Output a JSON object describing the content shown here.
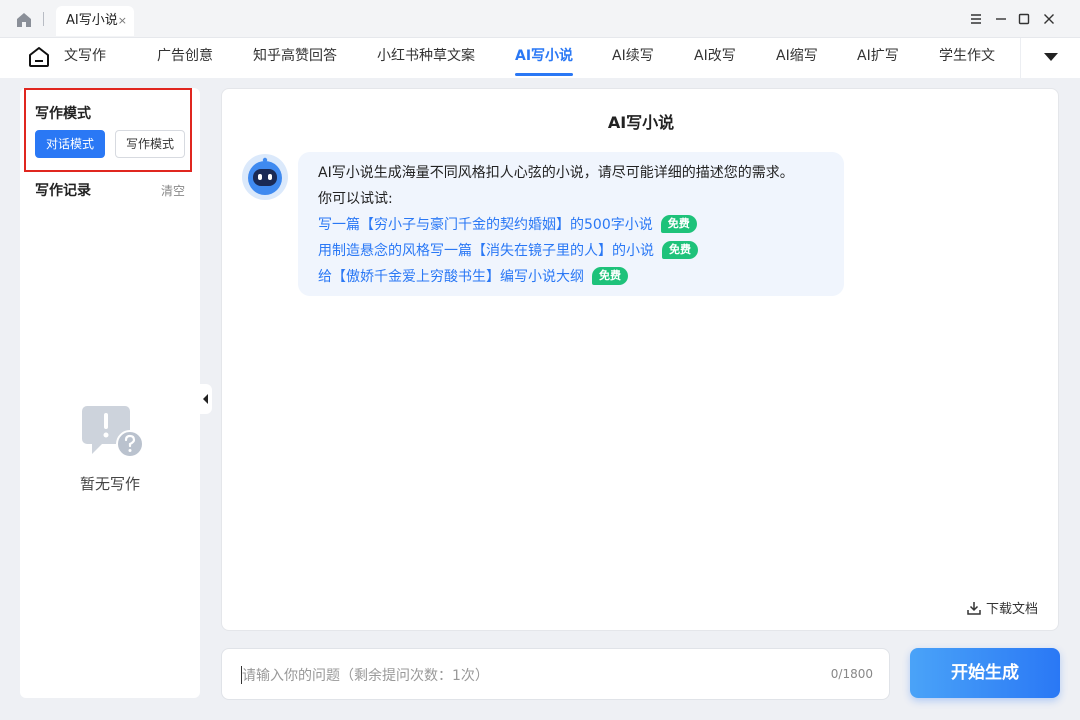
{
  "titlebar": {
    "tab_label": "AI写小说",
    "tab_close": "×"
  },
  "nav": {
    "items": [
      {
        "label": "文写作"
      },
      {
        "label": "广告创意"
      },
      {
        "label": "知乎高赞回答"
      },
      {
        "label": "小红书种草文案"
      },
      {
        "label": "AI写小说",
        "active": true
      },
      {
        "label": "AI续写"
      },
      {
        "label": "AI改写"
      },
      {
        "label": "AI缩写"
      },
      {
        "label": "AI扩写"
      },
      {
        "label": "学生作文"
      }
    ]
  },
  "sidebar": {
    "mode_title": "写作模式",
    "mode_buttons": [
      "对话模式",
      "写作模式"
    ],
    "active_mode": "对话模式",
    "records_title": "写作记录",
    "clear_label": "清空",
    "empty_text": "暂无写作"
  },
  "main": {
    "title": "AI写小说",
    "intro": "AI写小说生成海量不同风格扣人心弦的小说，请尽可能详细的描述您的需求。",
    "try_label": "你可以试试:",
    "suggestions": [
      {
        "text": "写一篇【穷小子与豪门千金的契约婚姻】的500字小说",
        "badge": "免费"
      },
      {
        "text": "用制造悬念的风格写一篇【消失在镜子里的人】的小说",
        "badge": "免费"
      },
      {
        "text": "给【傲娇千金爱上穷酸书生】编写小说大纲",
        "badge": "免费"
      }
    ],
    "download_label": "下载文档"
  },
  "input": {
    "placeholder": "请输入你的问题（剩余提问次数：1次）",
    "counter": "0/1800",
    "submit_label": "开始生成"
  },
  "colors": {
    "accent": "#2a78f5",
    "badge": "#1ec27a",
    "highlight": "#e0261f"
  }
}
